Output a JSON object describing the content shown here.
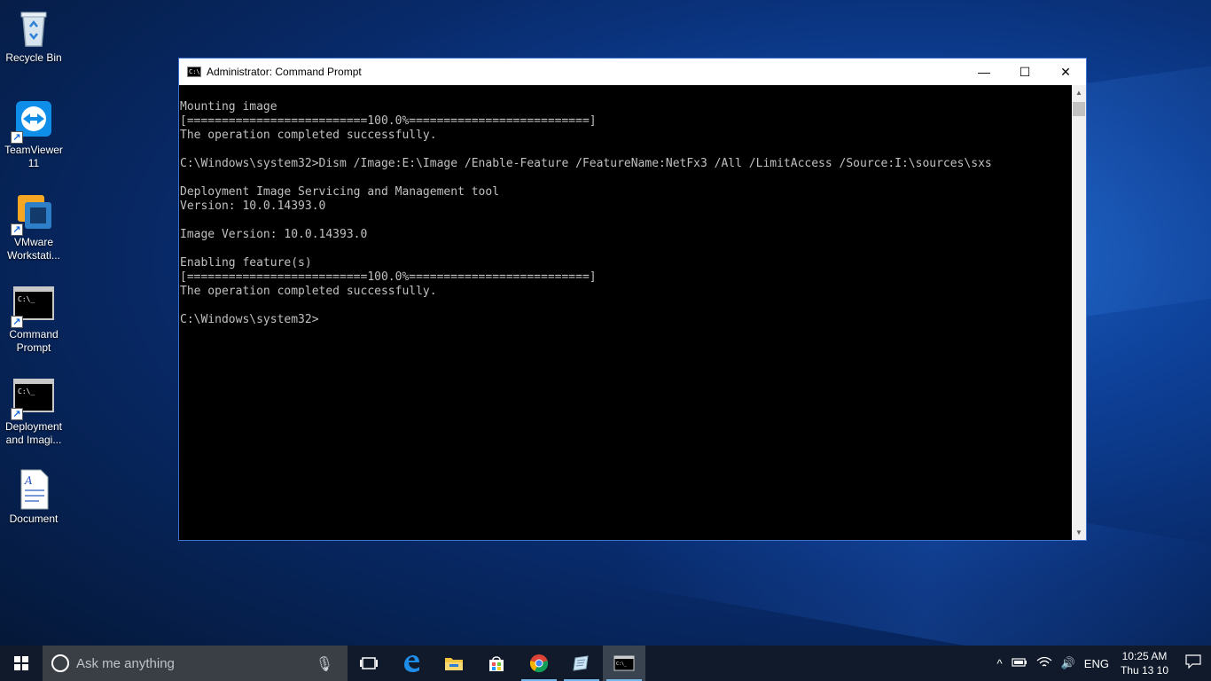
{
  "desktop": {
    "icons": [
      {
        "label": "Recycle Bin",
        "icon": "recycle-bin-icon"
      },
      {
        "label": "TeamViewer 11",
        "icon": "teamviewer-icon"
      },
      {
        "label": "VMware Workstati...",
        "icon": "vmware-icon"
      },
      {
        "label": "Command Prompt",
        "icon": "cmd-icon"
      },
      {
        "label": "Deployment and Imagi...",
        "icon": "cmd-icon"
      },
      {
        "label": "Document",
        "icon": "document-icon"
      }
    ]
  },
  "window": {
    "title": "Administrator: Command Prompt",
    "minimize": "—",
    "maximize": "☐",
    "close": "✕",
    "console_lines": [
      "Mounting image",
      "[==========================100.0%==========================]",
      "The operation completed successfully.",
      "",
      "C:\\Windows\\system32>Dism /Image:E:\\Image /Enable-Feature /FeatureName:NetFx3 /All /LimitAccess /Source:I:\\sources\\sxs",
      "",
      "Deployment Image Servicing and Management tool",
      "Version: 10.0.14393.0",
      "",
      "Image Version: 10.0.14393.0",
      "",
      "Enabling feature(s)",
      "[==========================100.0%==========================]",
      "The operation completed successfully.",
      "",
      "C:\\Windows\\system32>"
    ]
  },
  "taskbar": {
    "search_placeholder": "Ask me anything",
    "apps": [
      "task-view-icon",
      "edge-icon",
      "file-explorer-icon",
      "store-icon",
      "chrome-icon",
      "notepad-icon",
      "cmd-icon"
    ],
    "tray": {
      "language": "ENG",
      "time": "10:25 AM",
      "date": "Thu 13 10"
    }
  }
}
